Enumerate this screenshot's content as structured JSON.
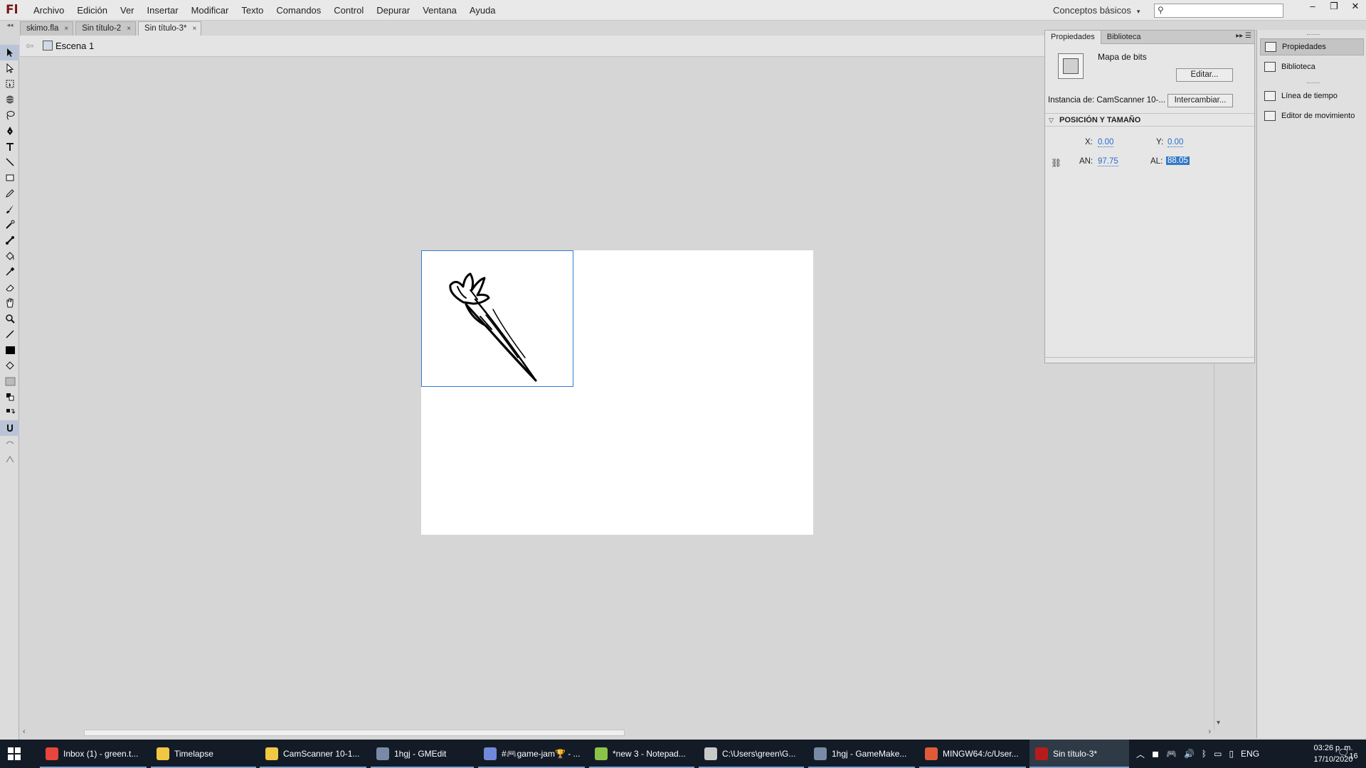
{
  "app": {
    "logo": "Fl",
    "menu": [
      "Archivo",
      "Edición",
      "Ver",
      "Insertar",
      "Modificar",
      "Texto",
      "Comandos",
      "Control",
      "Depurar",
      "Ventana",
      "Ayuda"
    ],
    "workspace": "Conceptos básicos",
    "search_placeholder": "",
    "window_controls": [
      "–",
      "❐",
      "✕"
    ]
  },
  "documents": {
    "tabs": [
      {
        "label": "skimo.fla",
        "active": false
      },
      {
        "label": "Sin título-2",
        "active": false
      },
      {
        "label": "Sin título-3*",
        "active": true
      }
    ],
    "close_glyph": "×"
  },
  "edit_bar": {
    "scene": "Escena 1"
  },
  "tools": [
    "selection-tool",
    "subselection-tool",
    "free-transform-tool",
    "3d-rotation-tool",
    "lasso-tool",
    "pen-tool",
    "text-tool",
    "line-tool",
    "rectangle-tool",
    "pencil-tool",
    "brush-tool",
    "deco-tool",
    "bone-tool",
    "paint-bucket-tool",
    "eyedropper-tool",
    "eraser-tool",
    "hand-tool",
    "zoom-tool",
    "stroke-color",
    "fill-color",
    "swap-colors",
    "snap-to-objects"
  ],
  "properties": {
    "tabs": [
      "Propiedades",
      "Biblioteca"
    ],
    "symbol_type": "Mapa de bits",
    "edit_button": "Editar...",
    "instance_label": "Instancia de:  CamScanner 10-...",
    "swap_button": "Intercambiar...",
    "section_title": "POSICIÓN Y TAMAÑO",
    "x_label": "X:",
    "x_value": "0.00",
    "y_label": "Y:",
    "y_value": "0.00",
    "w_label": "AN:",
    "w_value": "97.75",
    "h_label": "AL:",
    "h_value": "88.05"
  },
  "dock": {
    "items": [
      "Propiedades",
      "Biblioteca",
      "Línea de tiempo",
      "Editor de movimiento"
    ]
  },
  "taskbar": {
    "items": [
      {
        "label": "Inbox (1) - green.t...",
        "icon_color": "#e8453c"
      },
      {
        "label": "Timelapse",
        "icon_color": "#f2c744"
      },
      {
        "label": "CamScanner 10-1...",
        "icon_color": "#f2c744"
      },
      {
        "label": "1hgj - GMEdit",
        "icon_color": "#7a8aa6"
      },
      {
        "label": "#🎮game-jam🏆 - ...",
        "icon_color": "#7289da"
      },
      {
        "label": "*new 3 - Notepad...",
        "icon_color": "#8bc34a"
      },
      {
        "label": "C:\\Users\\green\\G...",
        "icon_color": "#c9c9c9"
      },
      {
        "label": "1hgj - GameMake...",
        "icon_color": "#7a8aa6"
      },
      {
        "label": "MINGW64:/c/User...",
        "icon_color": "#e05a3a"
      },
      {
        "label": "Sin título-3*",
        "icon_color": "#b71c1c"
      }
    ],
    "lang": "ENG",
    "time": "03:26 p. m.",
    "date": "17/10/2020",
    "notification_count": "16"
  },
  "colors": {
    "selection_blue": "#2f7bd6",
    "value_blue": "#2a6ccf",
    "taskbar": "#121b26"
  }
}
